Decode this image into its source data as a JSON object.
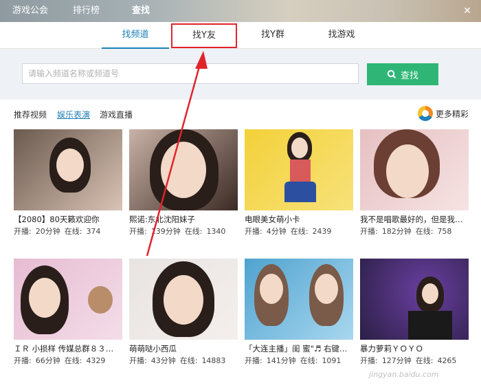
{
  "titlebar": {
    "tabs": [
      {
        "label": "游戏公会"
      },
      {
        "label": "排行榜"
      },
      {
        "label": "查找"
      }
    ],
    "close_label": "✕"
  },
  "subtabs": [
    {
      "label": "找频道",
      "active": true
    },
    {
      "label": "找Y友",
      "highlighted": true
    },
    {
      "label": "找Y群"
    },
    {
      "label": "找游戏"
    }
  ],
  "search": {
    "placeholder": "请输入频道名称或频道号",
    "value": "",
    "button_label": "查找",
    "button_color": "#2fb676"
  },
  "categories": {
    "label": "推荐视频",
    "items": [
      {
        "label": "娱乐表演",
        "active": true
      },
      {
        "label": "游戏直播"
      }
    ],
    "more_label": "更多精彩"
  },
  "videos": [
    {
      "title": "【2080】80天籁欢迎你",
      "duration_label": "开播:",
      "duration": "20分钟",
      "online_label": "在线:",
      "online": "374",
      "colors": [
        "#6b5a4e",
        "#d9c3b5"
      ]
    },
    {
      "title": "熙诺:东北沈阳妹子",
      "duration_label": "开播:",
      "duration": "139分钟",
      "online_label": "在线:",
      "online": "1340",
      "colors": [
        "#c9b2a6",
        "#3b2a24"
      ]
    },
    {
      "title": "电眼美女萌小卡",
      "duration_label": "开播:",
      "duration": "4分钟",
      "online_label": "在线:",
      "online": "2439",
      "colors": [
        "#f3d13a",
        "#f7e27a"
      ]
    },
    {
      "title": "我不是唱歌最好的，但是我…",
      "duration_label": "开播:",
      "duration": "182分钟",
      "online_label": "在线:",
      "online": "758",
      "colors": [
        "#e6c0c2",
        "#f6e3e3"
      ]
    },
    {
      "title": "ＩＲ 小损样 传媒总群８３…",
      "duration_label": "开播:",
      "duration": "66分钟",
      "online_label": "在线:",
      "online": "4329",
      "colors": [
        "#e7bcd2",
        "#f3dde8"
      ]
    },
    {
      "title": "萌萌哒小西瓜",
      "duration_label": "开播:",
      "duration": "43分钟",
      "online_label": "在线:",
      "online": "14883",
      "colors": [
        "#e8e4e2",
        "#f4efed"
      ]
    },
    {
      "title": "「大连主播」闺 蜜\"♬ 右键…",
      "duration_label": "开播:",
      "duration": "141分钟",
      "online_label": "在线:",
      "online": "1091",
      "colors": [
        "#4fa3cf",
        "#a9d7ef"
      ]
    },
    {
      "title": "暴力萝莉ＹＯＹＯ",
      "duration_label": "开播:",
      "duration": "127分钟",
      "online_label": "在线:",
      "online": "4265",
      "colors": [
        "#2a1f45",
        "#6a3fa0"
      ]
    }
  ],
  "annotation": {
    "color": "#e0242c"
  },
  "watermark": "jingyan.baidu.com"
}
